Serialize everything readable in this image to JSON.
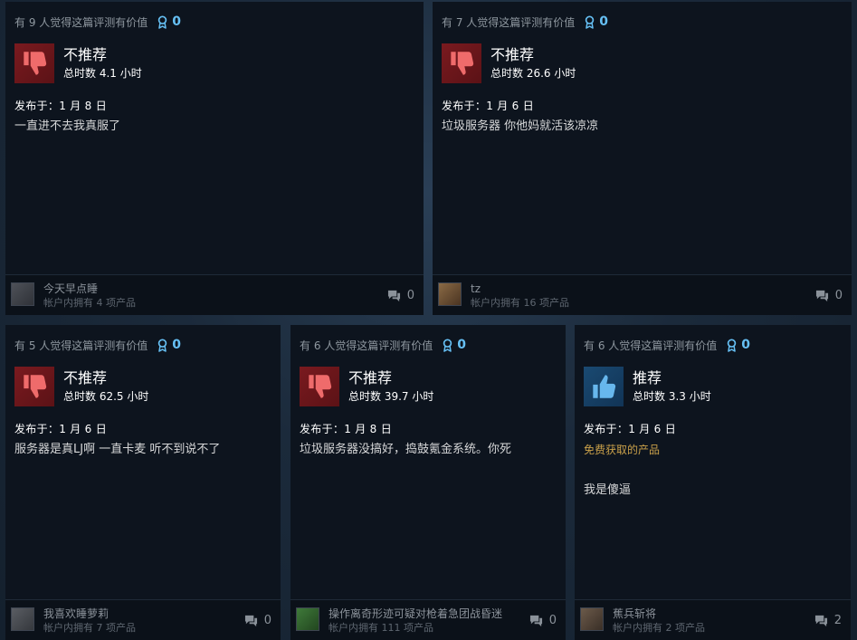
{
  "reviews": [
    {
      "helpful": "有 9 人觉得这篇评测有价值",
      "awards": "0",
      "verdict": "不推荐",
      "hours": "总时数 4.1 小时",
      "posted": "发布于：1 月 8 日",
      "free_note": "",
      "content": "一直进不去我真服了",
      "author": "今天早点睡",
      "owned": "帐户内拥有 4 项产品",
      "comments": "0",
      "recommended": false
    },
    {
      "helpful": "有 7 人觉得这篇评测有价值",
      "awards": "0",
      "verdict": "不推荐",
      "hours": "总时数 26.6 小时",
      "posted": "发布于：1 月 6 日",
      "free_note": "",
      "content": "垃圾服务器 你他妈就活该凉凉",
      "author": "tz",
      "owned": "帐户内拥有 16 项产品",
      "comments": "0",
      "recommended": false
    },
    {
      "helpful": "有 5 人觉得这篇评测有价值",
      "awards": "0",
      "verdict": "不推荐",
      "hours": "总时数 62.5 小时",
      "posted": "发布于：1 月 6 日",
      "free_note": "",
      "content": "服务器是真LJ啊 一直卡麦 听不到说不了",
      "author": "我喜欢睡萝莉",
      "owned": "帐户内拥有 7 项产品",
      "comments": "0",
      "recommended": false
    },
    {
      "helpful": "有 6 人觉得这篇评测有价值",
      "awards": "0",
      "verdict": "不推荐",
      "hours": "总时数 39.7 小时",
      "posted": "发布于：1 月 8 日",
      "free_note": "",
      "content": "垃圾服务器没搞好，捣鼓氪金系统。你死",
      "author": "操作离奇形迹可疑对枪着急团战昏迷",
      "owned": "帐户内拥有 111 项产品",
      "comments": "0",
      "recommended": false
    },
    {
      "helpful": "有 6 人觉得这篇评测有价值",
      "awards": "0",
      "verdict": "推荐",
      "hours": "总时数 3.3 小时",
      "posted": "发布于：1 月 6 日",
      "free_note": "免费获取的产品",
      "content": "我是傻逼",
      "author": "蕉兵斩将",
      "owned": "帐户内拥有 2 项产品",
      "comments": "2",
      "recommended": true
    }
  ],
  "colors": {
    "accent": "#66c0f4",
    "card_bg": "#0d141e",
    "thumb_down": "#7a1a1f",
    "thumb_up": "#1a4a72",
    "free_note": "#c9a04a"
  },
  "icons": {
    "award": "award-icon",
    "thumbs_down": "thumbs-down-icon",
    "thumbs_up": "thumbs-up-icon",
    "comments": "comment-icon"
  }
}
